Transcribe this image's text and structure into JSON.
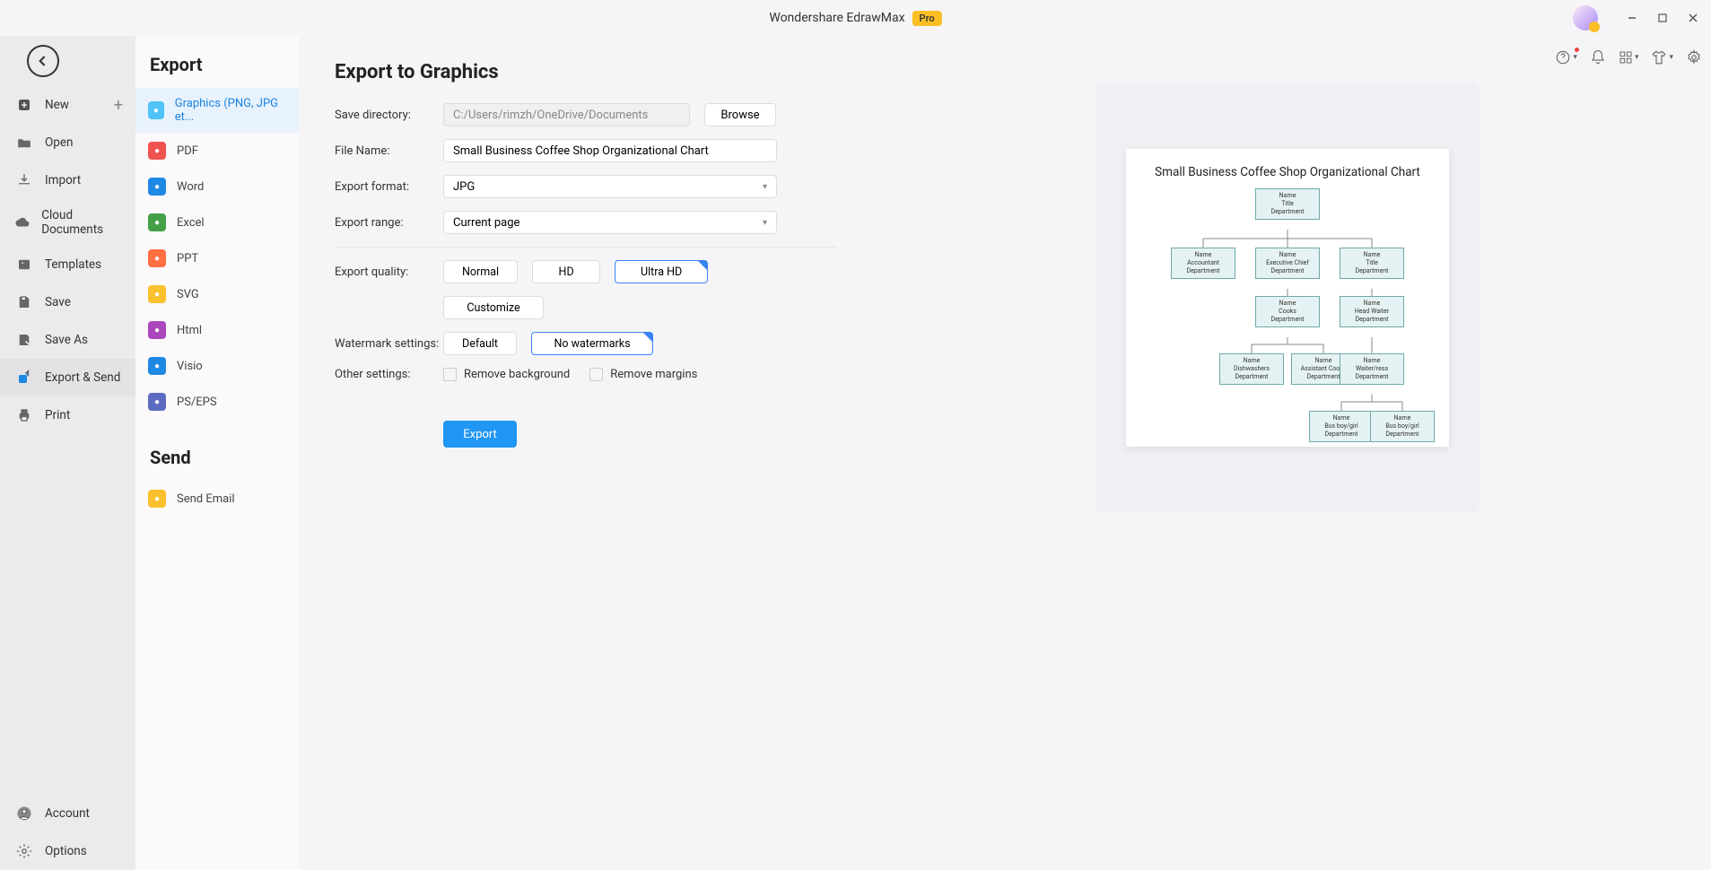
{
  "app": {
    "title": "Wondershare EdrawMax",
    "badge": "Pro"
  },
  "sidebar1": {
    "items": [
      {
        "label": "New",
        "icon": "plus-square",
        "hasPlus": true
      },
      {
        "label": "Open",
        "icon": "folder"
      },
      {
        "label": "Import",
        "icon": "download"
      },
      {
        "label": "Cloud Documents",
        "icon": "cloud"
      },
      {
        "label": "Templates",
        "icon": "template"
      },
      {
        "label": "Save",
        "icon": "save"
      },
      {
        "label": "Save As",
        "icon": "save-as"
      },
      {
        "label": "Export & Send",
        "icon": "export",
        "active": true
      },
      {
        "label": "Print",
        "icon": "print"
      }
    ],
    "footer": [
      {
        "label": "Account",
        "icon": "account"
      },
      {
        "label": "Options",
        "icon": "gear"
      }
    ]
  },
  "sidebar2": {
    "heading_export": "Export",
    "heading_send": "Send",
    "export_items": [
      {
        "label": "Graphics (PNG, JPG et...",
        "color": "#4fc3f7",
        "active": true
      },
      {
        "label": "PDF",
        "color": "#ef5350"
      },
      {
        "label": "Word",
        "color": "#1e88e5"
      },
      {
        "label": "Excel",
        "color": "#43a047"
      },
      {
        "label": "PPT",
        "color": "#ff7043"
      },
      {
        "label": "SVG",
        "color": "#fbc02d"
      },
      {
        "label": "Html",
        "color": "#ab47bc"
      },
      {
        "label": "Visio",
        "color": "#1e88e5"
      },
      {
        "label": "PS/EPS",
        "color": "#5c6bc0"
      }
    ],
    "send_items": [
      {
        "label": "Send Email",
        "color": "#fbc02d"
      }
    ]
  },
  "form": {
    "heading": "Export to Graphics",
    "labels": {
      "save_dir": "Save directory:",
      "file_name": "File Name:",
      "export_format": "Export format:",
      "export_range": "Export range:",
      "export_quality": "Export quality:",
      "watermark": "Watermark settings:",
      "other": "Other settings:"
    },
    "save_dir_value": "C:/Users/rimzh/OneDrive/Documents",
    "file_name_value": "Small Business Coffee Shop Organizational Chart",
    "export_format_value": "JPG",
    "export_range_value": "Current page",
    "browse": "Browse",
    "quality": {
      "normal": "Normal",
      "hd": "HD",
      "ultra": "Ultra HD",
      "custom": "Customize"
    },
    "watermark_default": "Default",
    "watermark_none": "No watermarks",
    "remove_bg": "Remove background",
    "remove_margins": "Remove margins",
    "export_btn": "Export"
  },
  "preview": {
    "title": "Small Business Coffee Shop Organizational Chart",
    "nodes": {
      "n1": "Name",
      "t1": "Title",
      "d1": "Department",
      "acc": "Accountant",
      "exec": "Executive Chief",
      "cooks": "Cooks",
      "headw": "Head Waiter",
      "dish": "Dishwashers",
      "asst": "Assistant Cooks",
      "wait": "Waiter/ress",
      "bus": "Bus boy/girl"
    }
  }
}
